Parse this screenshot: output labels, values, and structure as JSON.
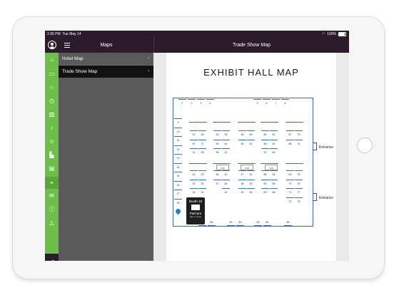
{
  "status_bar": {
    "time": "2:36 PM",
    "date": "Tue May 14",
    "battery": "100%"
  },
  "nav": {
    "left_title": "Maps",
    "right_title": "Trade Show Map"
  },
  "rail_icons": [
    "home-icon",
    "school-icon",
    "star-icon",
    "clock-icon",
    "building-icon",
    "microphone-icon",
    "people-icon",
    "chart-icon",
    "newspaper-icon",
    "map-pin-icon",
    "mail-icon",
    "info-icon",
    "warning-icon"
  ],
  "rail_active": "map-pin-icon",
  "rail_bottom_icons": [
    "logout-icon",
    "refresh-icon"
  ],
  "menu": {
    "items": [
      {
        "label": "Hotel Map",
        "chevron": "›",
        "active": false
      },
      {
        "label": "Trade Show Map",
        "chevron": "›",
        "active": true
      }
    ]
  },
  "map": {
    "title": "EXHIBIT HALL MAP",
    "entrance_label": "Entrance",
    "booths_top": [
      "1",
      "2",
      "3",
      "4",
      "5",
      "6",
      "7",
      "8"
    ],
    "booths_left": [
      "9",
      "10",
      "11",
      "12",
      "13",
      "14",
      "15",
      "16",
      "17",
      "18"
    ],
    "booths_grid": [
      [
        "19",
        "20",
        "21"
      ],
      [
        "26",
        "27",
        "28"
      ],
      [
        "33",
        "34",
        "35"
      ],
      [
        "39",
        "40",
        "41"
      ],
      [
        "45",
        "46"
      ],
      [
        "50",
        "51"
      ],
      [
        "55",
        "56",
        "57"
      ],
      [
        "61",
        "62",
        "63"
      ],
      [
        "67",
        "68"
      ],
      [
        "73",
        "74"
      ],
      [
        "22",
        "23",
        "24"
      ],
      [
        "29",
        "30",
        "31"
      ],
      [
        "36",
        "37"
      ],
      [
        "42",
        "43",
        "44"
      ],
      [
        "47",
        "48",
        "49"
      ],
      [
        "52",
        "53",
        "54"
      ],
      [
        "58",
        "59",
        "60"
      ],
      [
        "64",
        "65",
        "66"
      ],
      [
        "69",
        "70",
        "71",
        "72"
      ],
      [
        "75",
        "76",
        "77",
        "78"
      ]
    ],
    "booths_bottom": [
      "79",
      "80",
      "81",
      "82",
      "83",
      "84",
      "85"
    ],
    "gray_boxes": [
      "F&B",
      "F&B",
      "F&B"
    ],
    "popup": {
      "booth": "Booth 18",
      "name": "PatCare",
      "hint": "(tap to view)"
    }
  }
}
